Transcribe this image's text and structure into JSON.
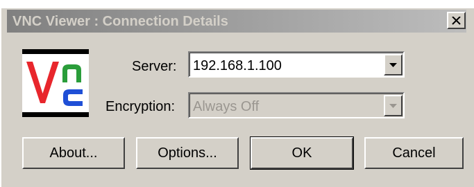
{
  "window": {
    "title": "VNC Viewer : Connection Details",
    "close_glyph": "✕"
  },
  "logo": {
    "icon": "vnc-logo-icon",
    "colors": {
      "v": "#e8262c",
      "n": "#2a9d3a",
      "c": "#1f4fd6",
      "bar": "#000000"
    }
  },
  "server": {
    "label": "Server:",
    "value": "192.168.1.100"
  },
  "encryption": {
    "label": "Encryption:",
    "value": "Always Off"
  },
  "buttons": {
    "about": "About...",
    "options": "Options...",
    "ok": "OK",
    "cancel": "Cancel"
  },
  "colors": {
    "dialog_bg": "#d4d0c8",
    "title_gradient_start": "#808080",
    "title_gradient_end": "#bdbdbd",
    "disabled_text": "#9a9690"
  }
}
